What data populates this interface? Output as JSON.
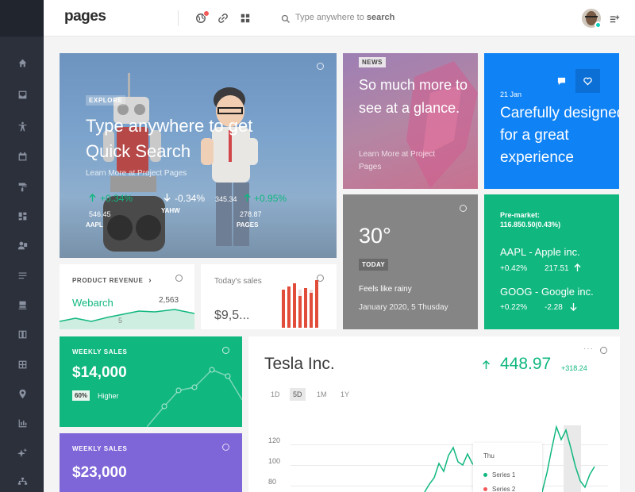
{
  "header": {
    "logo": "pages",
    "search_placeholder": "Type anywhere to",
    "search_keyword": "search"
  },
  "explore": {
    "tag": "EXPLORE",
    "title": "Type anywhere to get Quick Search",
    "subtitle": "Learn More at Project Pages",
    "stock1_pct": "+0.34%",
    "stock1_price": "546.45",
    "stock1_symbol": "AAPL",
    "stock2_pct": "0.34%",
    "stock2_symbol": "YAHW",
    "stock2_price": "345.34",
    "stock3_pct": "+0.95%",
    "stock3_price": "278.87",
    "stock3_symbol": "PAGES"
  },
  "news": {
    "tag": "NEWS",
    "title": "So much more to see at a glance.",
    "subtitle": "Learn More at Project Pages"
  },
  "feature": {
    "date": "21 Jan",
    "title": "Carefully designed for a great experience"
  },
  "weather": {
    "temp": "30°",
    "badge": "TODAY",
    "feels": "Feels like rainy",
    "date": "January 2020, 5 Thusday"
  },
  "market": {
    "premarket_label": "Pre-market:",
    "premarket_value": "116.850.50(0.43%)",
    "stock1_name": "AAPL - Apple inc.",
    "stock1_pct": "+0.42%",
    "stock1_price": "217.51",
    "stock2_name": "GOOG - Google inc.",
    "stock2_pct": "+0.22%",
    "stock2_price": "-2.28"
  },
  "product": {
    "title": "PRODUCT REVENUE",
    "name": "Webarch",
    "value": "2,563",
    "tick": "5"
  },
  "today": {
    "title": "Today's sales",
    "value": "$9,5..."
  },
  "weekly1": {
    "title": "WEEKLY SALES",
    "value": "$14,000",
    "badge": "60%",
    "trend": "Higher"
  },
  "weekly2": {
    "title": "WEEKLY SALES",
    "value": "$23,000"
  },
  "tesla": {
    "name": "Tesla Inc.",
    "price": "448.97",
    "change": "+318.24",
    "tabs": [
      "1D",
      "5D",
      "1M",
      "1Y"
    ],
    "active_tab": "5D",
    "tooltip_title": "Thu",
    "series1": "Series 1",
    "series2": "Series 2"
  },
  "chart_data": {
    "type": "line",
    "yticks": [
      "120",
      "100",
      "80"
    ],
    "series": [
      {
        "name": "Series 1",
        "color": "#10b77f"
      },
      {
        "name": "Series 2",
        "color": "#f35958"
      }
    ]
  },
  "colors": {
    "green": "#10b77f",
    "blue": "#0f82f5",
    "purple": "#7e65d8",
    "red": "#f35958",
    "sidebar": "#2b303b"
  }
}
